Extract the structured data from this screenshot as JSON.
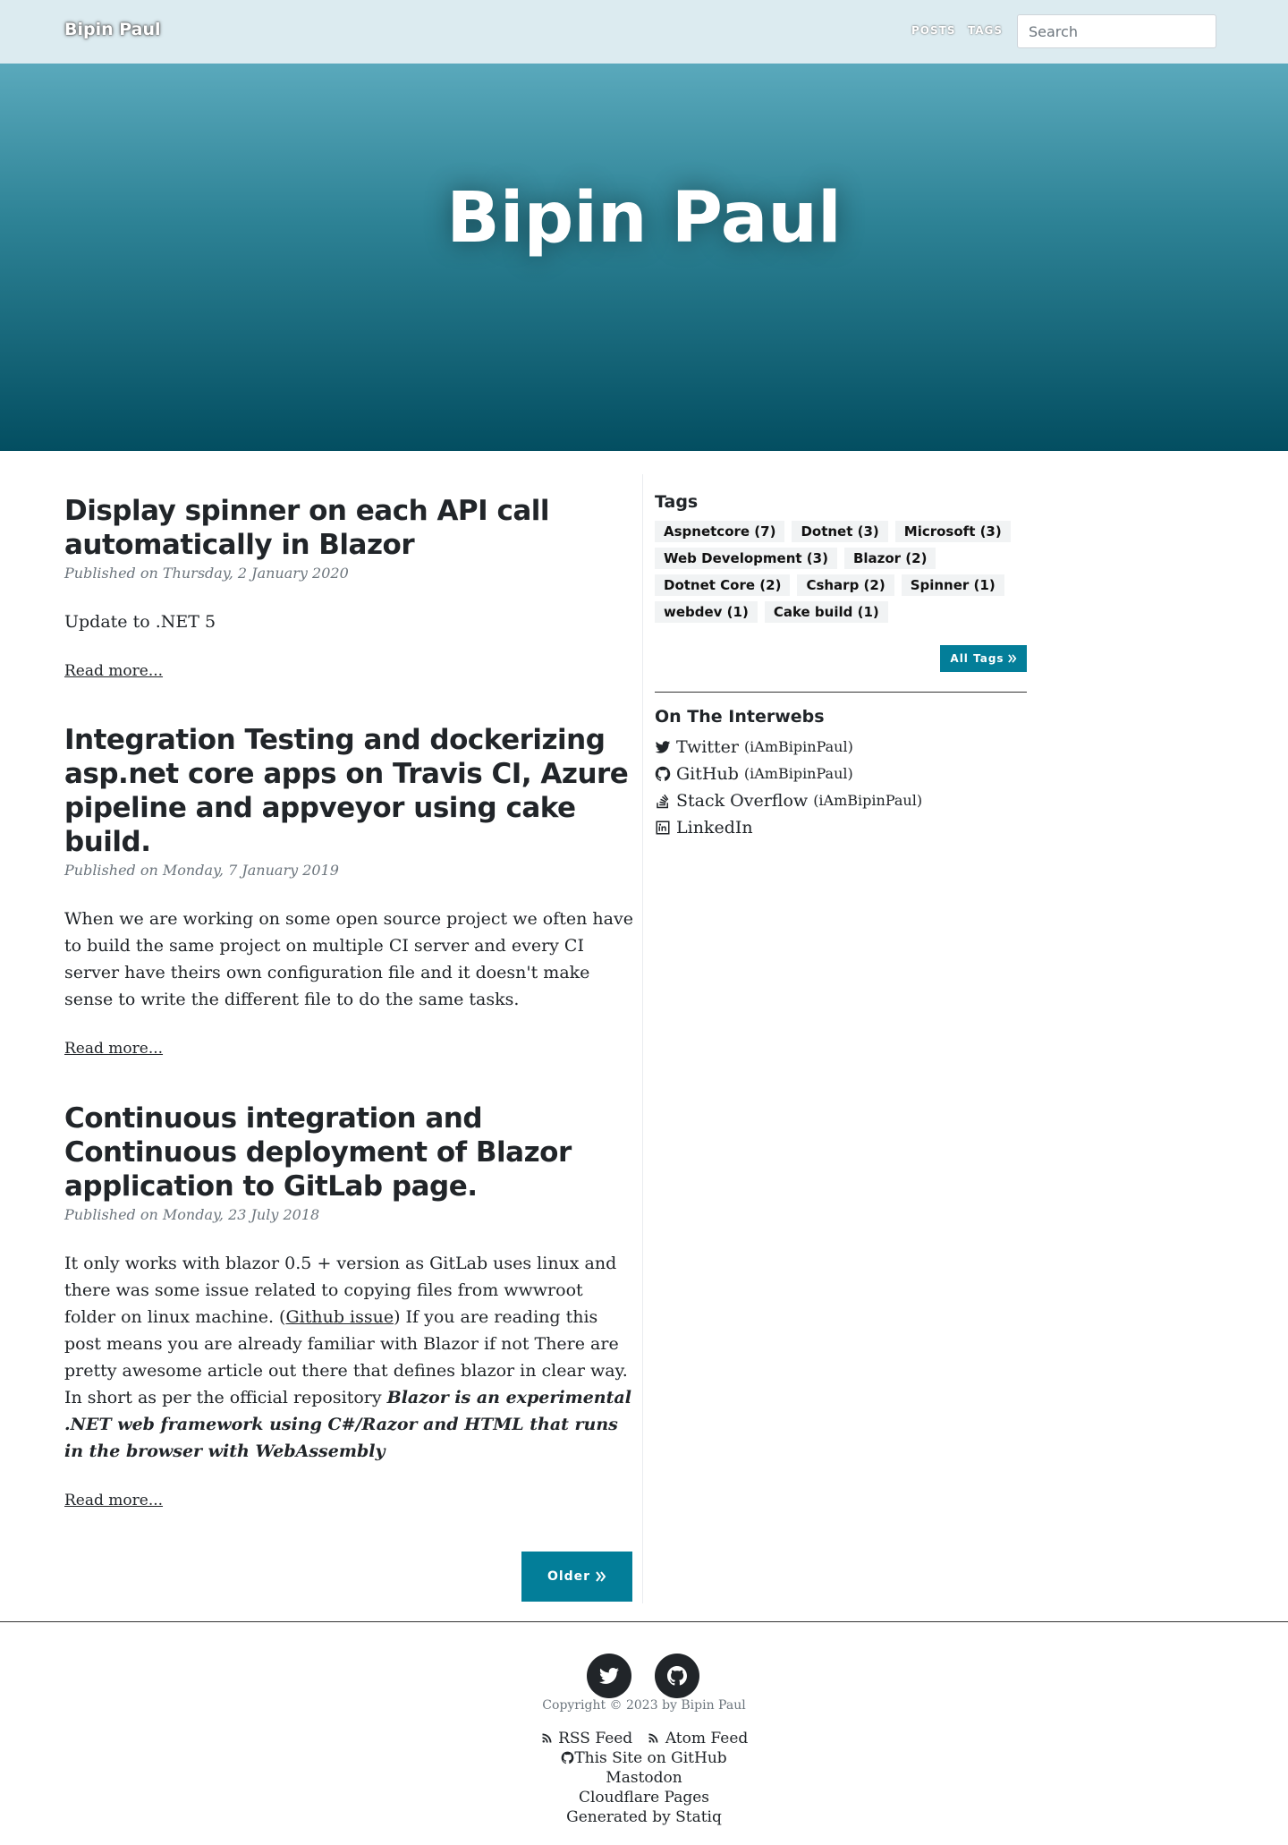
{
  "navbar": {
    "brand": "Bipin Paul",
    "links": [
      "POSTS",
      "TAGS"
    ],
    "search_placeholder": "Search"
  },
  "hero": {
    "title": "Bipin Paul"
  },
  "posts": [
    {
      "title": "Display spinner on each API call automatically in Blazor",
      "date": "Published on Thursday, 2 January 2020",
      "excerpt": "Update to .NET 5",
      "read_more": "Read more..."
    },
    {
      "title": "Integration Testing and dockerizing asp.net core apps on Travis CI, Azure pipeline and appveyor using cake build.",
      "date": "Published on Monday, 7 January 2019",
      "excerpt": "When we are working on some open source project we often have to build the same project on multiple CI server and every CI server have theirs own configuration file and it doesn't make sense to write the different file to do the same tasks.",
      "read_more": "Read more..."
    },
    {
      "title": "Continuous integration and Continuous deployment of Blazor application to GitLab page.",
      "date": "Published on Monday, 23 July 2018",
      "excerpt_part1": "It only works with blazor 0.5 + version as GitLab uses linux and there was some issue related to copying files from wwwroot folder on linux machine. (",
      "excerpt_link": "Github issue",
      "excerpt_part2": ") If you are reading this post means you are already familiar with Blazor if not There are pretty awesome article out there that defines blazor in clear way. In short as per the official repository ",
      "excerpt_strong": "Blazor is an experimental .NET web framework using C#/Razor and HTML that runs in the browser with WebAssembly",
      "read_more": "Read more..."
    }
  ],
  "older_button": "Older",
  "sidebar": {
    "tags_heading": "Tags",
    "tags": [
      "Aspnetcore (7)",
      "Dotnet (3)",
      "Microsoft (3)",
      "Web Development (3)",
      "Blazor (2)",
      "Dotnet Core (2)",
      "Csharp (2)",
      "Spinner (1)",
      "webdev (1)",
      "Cake build (1)"
    ],
    "all_tags": "All Tags",
    "interwebs_heading": "On The Interwebs",
    "links": [
      {
        "label": "Twitter",
        "handle": "(iAmBipinPaul)",
        "icon": "twitter-icon"
      },
      {
        "label": "GitHub",
        "handle": "(iAmBipinPaul)",
        "icon": "github-icon"
      },
      {
        "label": "Stack Overflow",
        "handle": "(iAmBipinPaul)",
        "icon": "stack-overflow-icon"
      },
      {
        "label": "LinkedIn",
        "handle": "",
        "icon": "linkedin-icon"
      }
    ]
  },
  "footer": {
    "copyright": "Copyright © 2023 by Bipin Paul",
    "rss": "RSS Feed",
    "atom": "Atom Feed",
    "github_site": "This Site on GitHub",
    "mastodon": "Mastodon",
    "cloudflare": "Cloudflare Pages",
    "generated": "Generated by Statiq"
  },
  "colors": {
    "accent": "#037e99",
    "navbar_bg": "#dcebf0",
    "hero_top": "#5aa9bc",
    "hero_bottom": "#034e61"
  }
}
